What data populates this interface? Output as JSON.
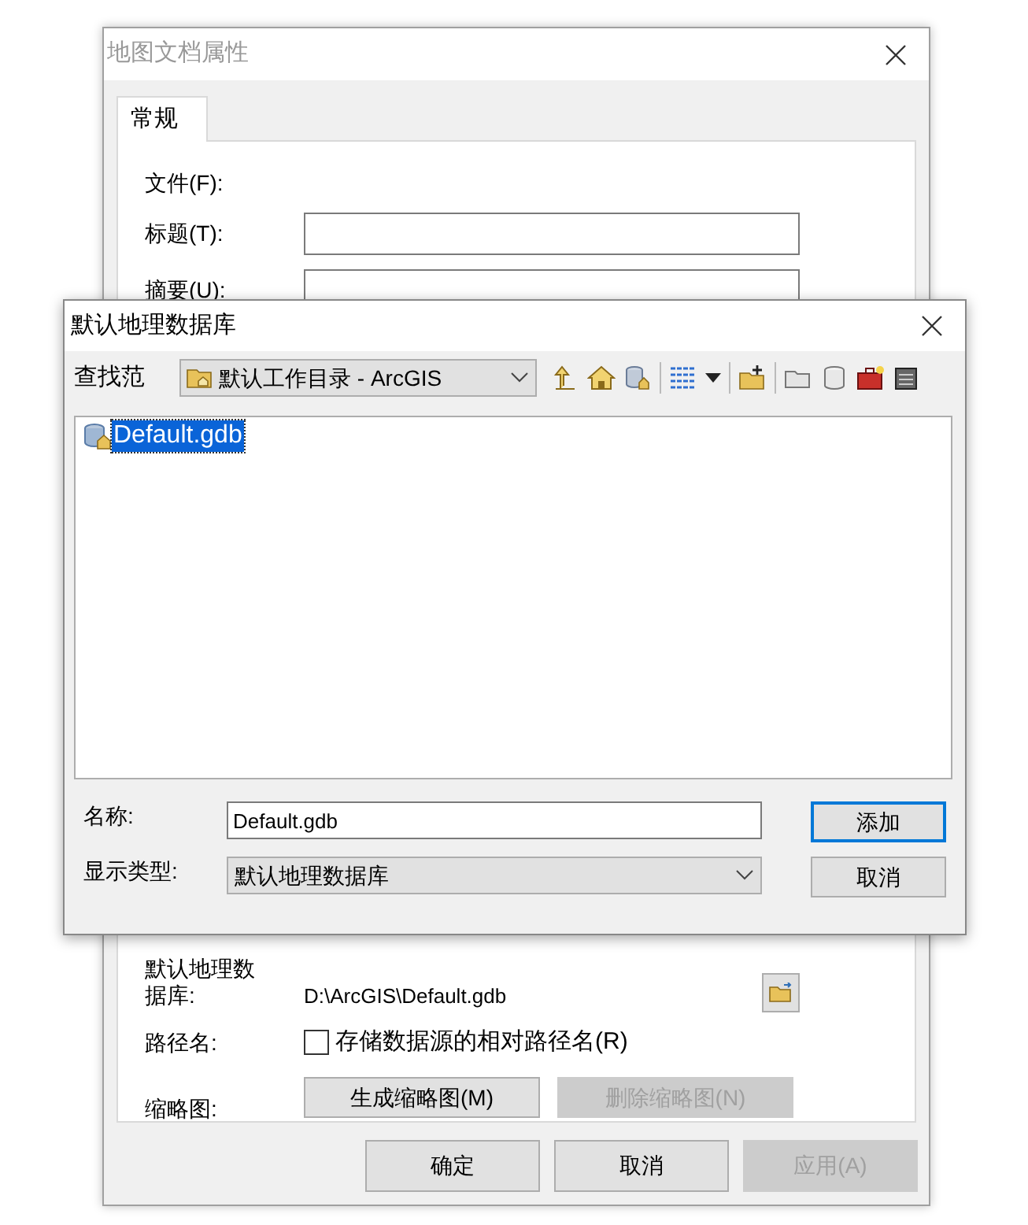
{
  "main_dialog": {
    "title": "地图文档属性",
    "tabs": [
      {
        "label": "常规",
        "selected": true
      }
    ],
    "fields": [
      {
        "label": "文件(F):",
        "kind": "text"
      },
      {
        "label": "标题(T):",
        "kind": "input"
      },
      {
        "label": "摘要(U):",
        "kind": "input"
      }
    ],
    "default_geodatabase": {
      "label": "默认地理数据库:",
      "path": "D:\\ArcGIS\\Default.gdb"
    },
    "pathnames": {
      "label": "路径名:",
      "checkbox_label": "存储数据源的相对路径名(R)",
      "checked": false
    },
    "thumbnail": {
      "label": "缩略图:",
      "buttons": [
        {
          "label": "生成缩略图(M)",
          "disabled": false
        },
        {
          "label": "删除缩略图(N)",
          "disabled": true
        }
      ]
    },
    "footer_buttons": [
      {
        "label": "确定",
        "disabled": false
      },
      {
        "label": "取消",
        "disabled": false
      },
      {
        "label": "应用(A)",
        "disabled": true
      }
    ]
  },
  "browse_dialog": {
    "title": "默认地理数据库",
    "look_in_label": "查找范",
    "look_in_value": "默认工作目录 - ArcGIS",
    "items": [
      {
        "name": "Default.gdb",
        "selected": true
      }
    ],
    "name_label": "名称:",
    "name_value": "Default.gdb",
    "type_label": "显示类型:",
    "type_value": "默认地理数据库",
    "buttons": [
      {
        "label": "添加",
        "focused": true
      },
      {
        "label": "取消",
        "focused": false
      }
    ]
  }
}
